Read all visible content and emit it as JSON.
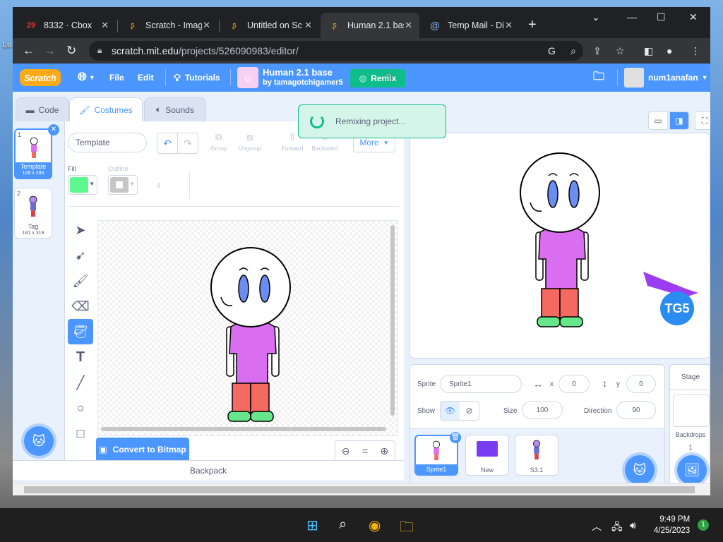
{
  "desktop": {
    "label": "Lu"
  },
  "browser": {
    "tabs": [
      {
        "title": "8332 · Cbox",
        "badge": "29"
      },
      {
        "title": "Scratch - Imag"
      },
      {
        "title": "Untitled on Sc"
      },
      {
        "title": "Human 2.1 bas"
      },
      {
        "title": "Temp Mail - Di"
      }
    ],
    "url_host": "scratch.mit.edu",
    "url_path": "/projects/526090983/editor/"
  },
  "menubar": {
    "logo": "Scratch",
    "file": "File",
    "edit": "Edit",
    "tutorials": "Tutorials",
    "project_title": "Human 2.1 base",
    "project_author": "by tamagotchigamer5",
    "remix": "Remix",
    "username": "num1anafan"
  },
  "toast": {
    "text": "Remixing project..."
  },
  "editor_tabs": {
    "code": "Code",
    "costumes": "Costumes",
    "sounds": "Sounds"
  },
  "costumes": [
    {
      "num": "1",
      "name": "Template",
      "size": "128 x 280"
    },
    {
      "num": "2",
      "name": "Tag",
      "size": "181 x 319"
    }
  ],
  "paint": {
    "costume_name": "Template",
    "group": "Group",
    "ungroup": "Ungroup",
    "forward": "Forward",
    "backward": "Backward",
    "more": "More",
    "fill_label": "Fill",
    "outline_label": "Outline",
    "outline_size": "4",
    "convert": "Convert to Bitmap"
  },
  "backpack": "Backpack",
  "sprite_info": {
    "sprite_label": "Sprite",
    "sprite_name": "Sprite1",
    "x_label": "x",
    "x": "0",
    "y_label": "y",
    "y": "0",
    "show_label": "Show",
    "size_label": "Size",
    "size": "100",
    "direction_label": "Direction",
    "direction": "90"
  },
  "sprites": [
    {
      "name": "Sprite1"
    },
    {
      "name": "New"
    },
    {
      "name": "S3.1"
    }
  ],
  "stage_pane": {
    "title": "Stage",
    "backdrops_label": "Backdrops",
    "backdrops_count": "1"
  },
  "stage_logo": "TG5",
  "taskbar": {
    "time": "9:49 PM",
    "date": "4/25/2023",
    "notifications": "1"
  },
  "colors": {
    "scratch_blue": "#4c97ff",
    "remix_green": "#0fbd8c",
    "fill": "#5cfa8c",
    "shirt": "#d96ef0",
    "pants": "#f56a60",
    "eyes": "#6b8cf0",
    "shoes": "#66e68a"
  }
}
